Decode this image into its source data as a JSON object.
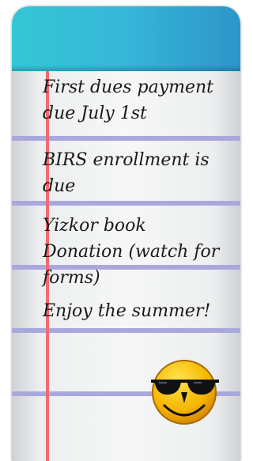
{
  "notes": [
    "First dues payment due July 1st",
    "BIRS enrollment is due",
    "Yizkor book Donation (watch for forms)",
    "Enjoy the summer!"
  ],
  "decoration": {
    "icon": "sunglasses-smiley-icon",
    "colors": {
      "header": "#36b6d9",
      "rule_lines": "#a9a8dc",
      "margin_line": "#f06b73",
      "smiley_face": "#f6b600"
    }
  }
}
